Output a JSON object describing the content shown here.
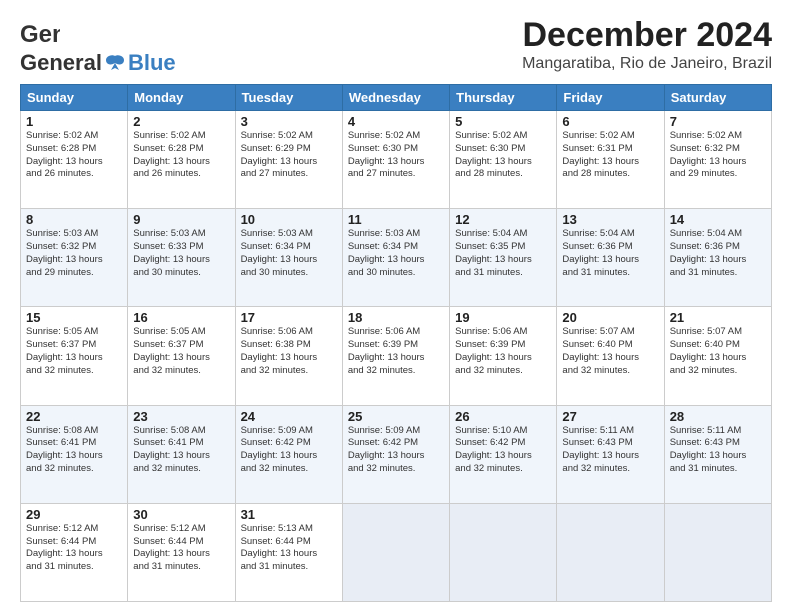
{
  "logo": {
    "part1": "General",
    "part2": "Blue"
  },
  "header": {
    "month": "December 2024",
    "location": "Mangaratiba, Rio de Janeiro, Brazil"
  },
  "days_of_week": [
    "Sunday",
    "Monday",
    "Tuesday",
    "Wednesday",
    "Thursday",
    "Friday",
    "Saturday"
  ],
  "weeks": [
    [
      {
        "day": "1",
        "info": "Sunrise: 5:02 AM\nSunset: 6:28 PM\nDaylight: 13 hours\nand 26 minutes."
      },
      {
        "day": "2",
        "info": "Sunrise: 5:02 AM\nSunset: 6:28 PM\nDaylight: 13 hours\nand 26 minutes."
      },
      {
        "day": "3",
        "info": "Sunrise: 5:02 AM\nSunset: 6:29 PM\nDaylight: 13 hours\nand 27 minutes."
      },
      {
        "day": "4",
        "info": "Sunrise: 5:02 AM\nSunset: 6:30 PM\nDaylight: 13 hours\nand 27 minutes."
      },
      {
        "day": "5",
        "info": "Sunrise: 5:02 AM\nSunset: 6:30 PM\nDaylight: 13 hours\nand 28 minutes."
      },
      {
        "day": "6",
        "info": "Sunrise: 5:02 AM\nSunset: 6:31 PM\nDaylight: 13 hours\nand 28 minutes."
      },
      {
        "day": "7",
        "info": "Sunrise: 5:02 AM\nSunset: 6:32 PM\nDaylight: 13 hours\nand 29 minutes."
      }
    ],
    [
      {
        "day": "8",
        "info": "Sunrise: 5:03 AM\nSunset: 6:32 PM\nDaylight: 13 hours\nand 29 minutes."
      },
      {
        "day": "9",
        "info": "Sunrise: 5:03 AM\nSunset: 6:33 PM\nDaylight: 13 hours\nand 30 minutes."
      },
      {
        "day": "10",
        "info": "Sunrise: 5:03 AM\nSunset: 6:34 PM\nDaylight: 13 hours\nand 30 minutes."
      },
      {
        "day": "11",
        "info": "Sunrise: 5:03 AM\nSunset: 6:34 PM\nDaylight: 13 hours\nand 30 minutes."
      },
      {
        "day": "12",
        "info": "Sunrise: 5:04 AM\nSunset: 6:35 PM\nDaylight: 13 hours\nand 31 minutes."
      },
      {
        "day": "13",
        "info": "Sunrise: 5:04 AM\nSunset: 6:36 PM\nDaylight: 13 hours\nand 31 minutes."
      },
      {
        "day": "14",
        "info": "Sunrise: 5:04 AM\nSunset: 6:36 PM\nDaylight: 13 hours\nand 31 minutes."
      }
    ],
    [
      {
        "day": "15",
        "info": "Sunrise: 5:05 AM\nSunset: 6:37 PM\nDaylight: 13 hours\nand 32 minutes."
      },
      {
        "day": "16",
        "info": "Sunrise: 5:05 AM\nSunset: 6:37 PM\nDaylight: 13 hours\nand 32 minutes."
      },
      {
        "day": "17",
        "info": "Sunrise: 5:06 AM\nSunset: 6:38 PM\nDaylight: 13 hours\nand 32 minutes."
      },
      {
        "day": "18",
        "info": "Sunrise: 5:06 AM\nSunset: 6:39 PM\nDaylight: 13 hours\nand 32 minutes."
      },
      {
        "day": "19",
        "info": "Sunrise: 5:06 AM\nSunset: 6:39 PM\nDaylight: 13 hours\nand 32 minutes."
      },
      {
        "day": "20",
        "info": "Sunrise: 5:07 AM\nSunset: 6:40 PM\nDaylight: 13 hours\nand 32 minutes."
      },
      {
        "day": "21",
        "info": "Sunrise: 5:07 AM\nSunset: 6:40 PM\nDaylight: 13 hours\nand 32 minutes."
      }
    ],
    [
      {
        "day": "22",
        "info": "Sunrise: 5:08 AM\nSunset: 6:41 PM\nDaylight: 13 hours\nand 32 minutes."
      },
      {
        "day": "23",
        "info": "Sunrise: 5:08 AM\nSunset: 6:41 PM\nDaylight: 13 hours\nand 32 minutes."
      },
      {
        "day": "24",
        "info": "Sunrise: 5:09 AM\nSunset: 6:42 PM\nDaylight: 13 hours\nand 32 minutes."
      },
      {
        "day": "25",
        "info": "Sunrise: 5:09 AM\nSunset: 6:42 PM\nDaylight: 13 hours\nand 32 minutes."
      },
      {
        "day": "26",
        "info": "Sunrise: 5:10 AM\nSunset: 6:42 PM\nDaylight: 13 hours\nand 32 minutes."
      },
      {
        "day": "27",
        "info": "Sunrise: 5:11 AM\nSunset: 6:43 PM\nDaylight: 13 hours\nand 32 minutes."
      },
      {
        "day": "28",
        "info": "Sunrise: 5:11 AM\nSunset: 6:43 PM\nDaylight: 13 hours\nand 31 minutes."
      }
    ],
    [
      {
        "day": "29",
        "info": "Sunrise: 5:12 AM\nSunset: 6:44 PM\nDaylight: 13 hours\nand 31 minutes."
      },
      {
        "day": "30",
        "info": "Sunrise: 5:12 AM\nSunset: 6:44 PM\nDaylight: 13 hours\nand 31 minutes."
      },
      {
        "day": "31",
        "info": "Sunrise: 5:13 AM\nSunset: 6:44 PM\nDaylight: 13 hours\nand 31 minutes."
      },
      {
        "day": "",
        "info": ""
      },
      {
        "day": "",
        "info": ""
      },
      {
        "day": "",
        "info": ""
      },
      {
        "day": "",
        "info": ""
      }
    ]
  ]
}
